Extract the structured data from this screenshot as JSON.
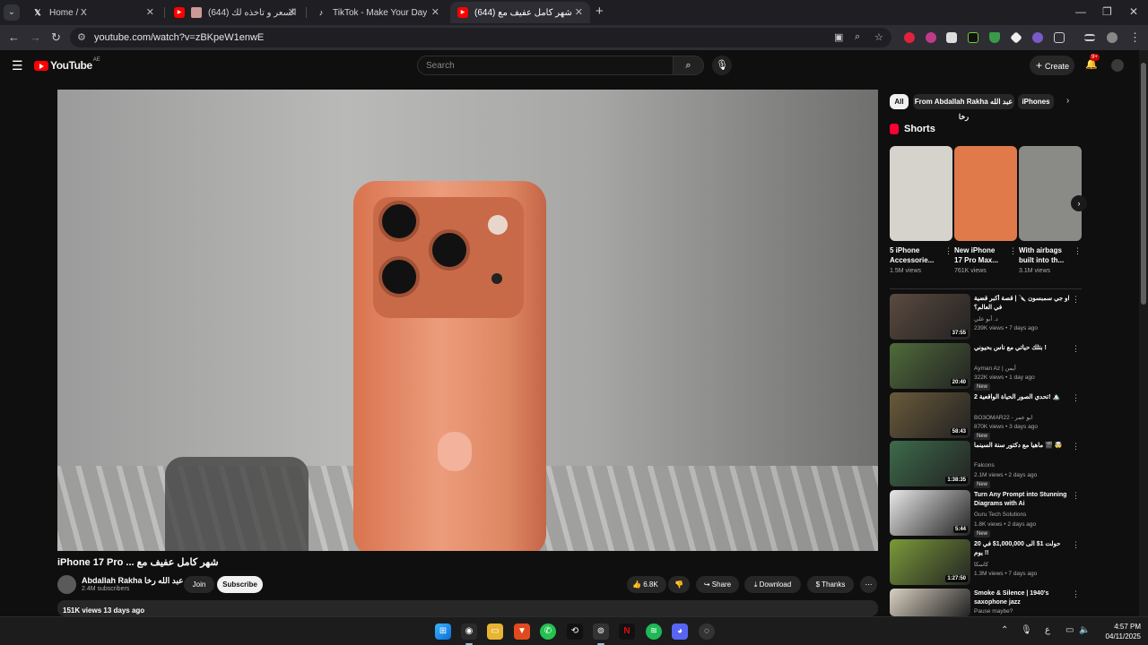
{
  "browser": {
    "tabs": [
      {
        "label": "Home / X",
        "icon": "x-icon"
      },
      {
        "label": "(644) خمن السعر و تاخذه لك",
        "icon": "youtube-icon"
      },
      {
        "label": "TikTok - Make Your Day",
        "icon": "tiktok-icon"
      },
      {
        "label": "(644) شهر كامل عفيف مع ... Tube",
        "icon": "youtube-icon"
      }
    ],
    "new_tab": "+",
    "url": "youtube.com/watch?v=zBKpeW1enwE"
  },
  "youtube": {
    "logo_text": "YouTube",
    "country_code": "AE",
    "search_placeholder": "Search",
    "create_label": "Create",
    "notifications_badge": "9+"
  },
  "video": {
    "title": "iPhone 17 Pro ... شهر كامل عفيف مع",
    "channel_name": "Abdallah Rakha عبد الله رخا",
    "subscribers": "2.4M subscribers",
    "join_label": "Join",
    "subscribe_label": "Subscribe",
    "likes": "6.8K",
    "share_label": "Share",
    "download_label": "Download",
    "thanks_label": "Thanks",
    "views_date": "151K views  13 days ago"
  },
  "sidebar": {
    "chips": [
      "All",
      "From Abdallah Rakha عبد الله رخا",
      "iPhones"
    ],
    "shorts_title": "Shorts",
    "shorts": [
      {
        "title": "5 iPhone Accessorie...",
        "views": "1.5M views",
        "color": "#d6d3cc"
      },
      {
        "title": "New iPhone 17 Pro Max...",
        "views": "761K views",
        "color": "#e07a4a"
      },
      {
        "title": "With airbags built into th...",
        "views": "3.1M views",
        "color": "#8a8a86"
      }
    ],
    "recommendations": [
      {
        "title": "او جي سمبسون 🔪 | قصة أكبر قضية في العالم؟",
        "channel": "د. أبو علي",
        "meta": "239K views • 7 days ago",
        "duration": "37:55",
        "new": "",
        "color": "#5b4a3f",
        "progress": 0.0
      },
      {
        "title": "بتلك حياتي مع ناس بحيوني !",
        "channel": "Ayman Az | أيمن",
        "meta": "322K views • 1 day ago",
        "duration": "20:40",
        "new": "New",
        "color": "#4f6b3a",
        "progress": 0.0
      },
      {
        "title": "تحدي الصور الحياة الواقعية 2! 🏔️",
        "channel": "BO3OMAR22 - ابو عمر",
        "meta": "870K views • 3 days ago",
        "duration": "58:43",
        "new": "New",
        "color": "#6a5a3a",
        "progress": 0.0
      },
      {
        "title": "ماهيا مع دكتور سنة السينما 🎬 🤯",
        "channel": "Falcons",
        "meta": "2.1M views • 2 days ago",
        "duration": "1:38:35",
        "new": "New",
        "color": "#3d6b4a",
        "progress": 0.0
      },
      {
        "title": "Turn Any Prompt into Stunning Diagrams with Ai",
        "channel": "Guru Tech Solutions",
        "meta": "1.8K views • 2 days ago",
        "duration": "5:44",
        "new": "New",
        "color": "#e8e8e8",
        "progress": 0.0
      },
      {
        "title": "حولت 1$ الى 1,000,000$ في 20 يوم !!",
        "channel": "كاسكا",
        "meta": "1.3M views • 7 days ago",
        "duration": "1:27:50",
        "new": "",
        "color": "#7a9a3a",
        "progress": 0.0
      },
      {
        "title": "Smoke & Silence | 1940's saxophone jazz",
        "channel": "Pause maybe?",
        "meta": "",
        "duration": "",
        "new": "",
        "color": "#d8d0c0",
        "progress": 0.0
      }
    ]
  },
  "taskbar": {
    "clock_time": "4:57 PM",
    "clock_date": "04/11/2025",
    "language": "ع"
  }
}
